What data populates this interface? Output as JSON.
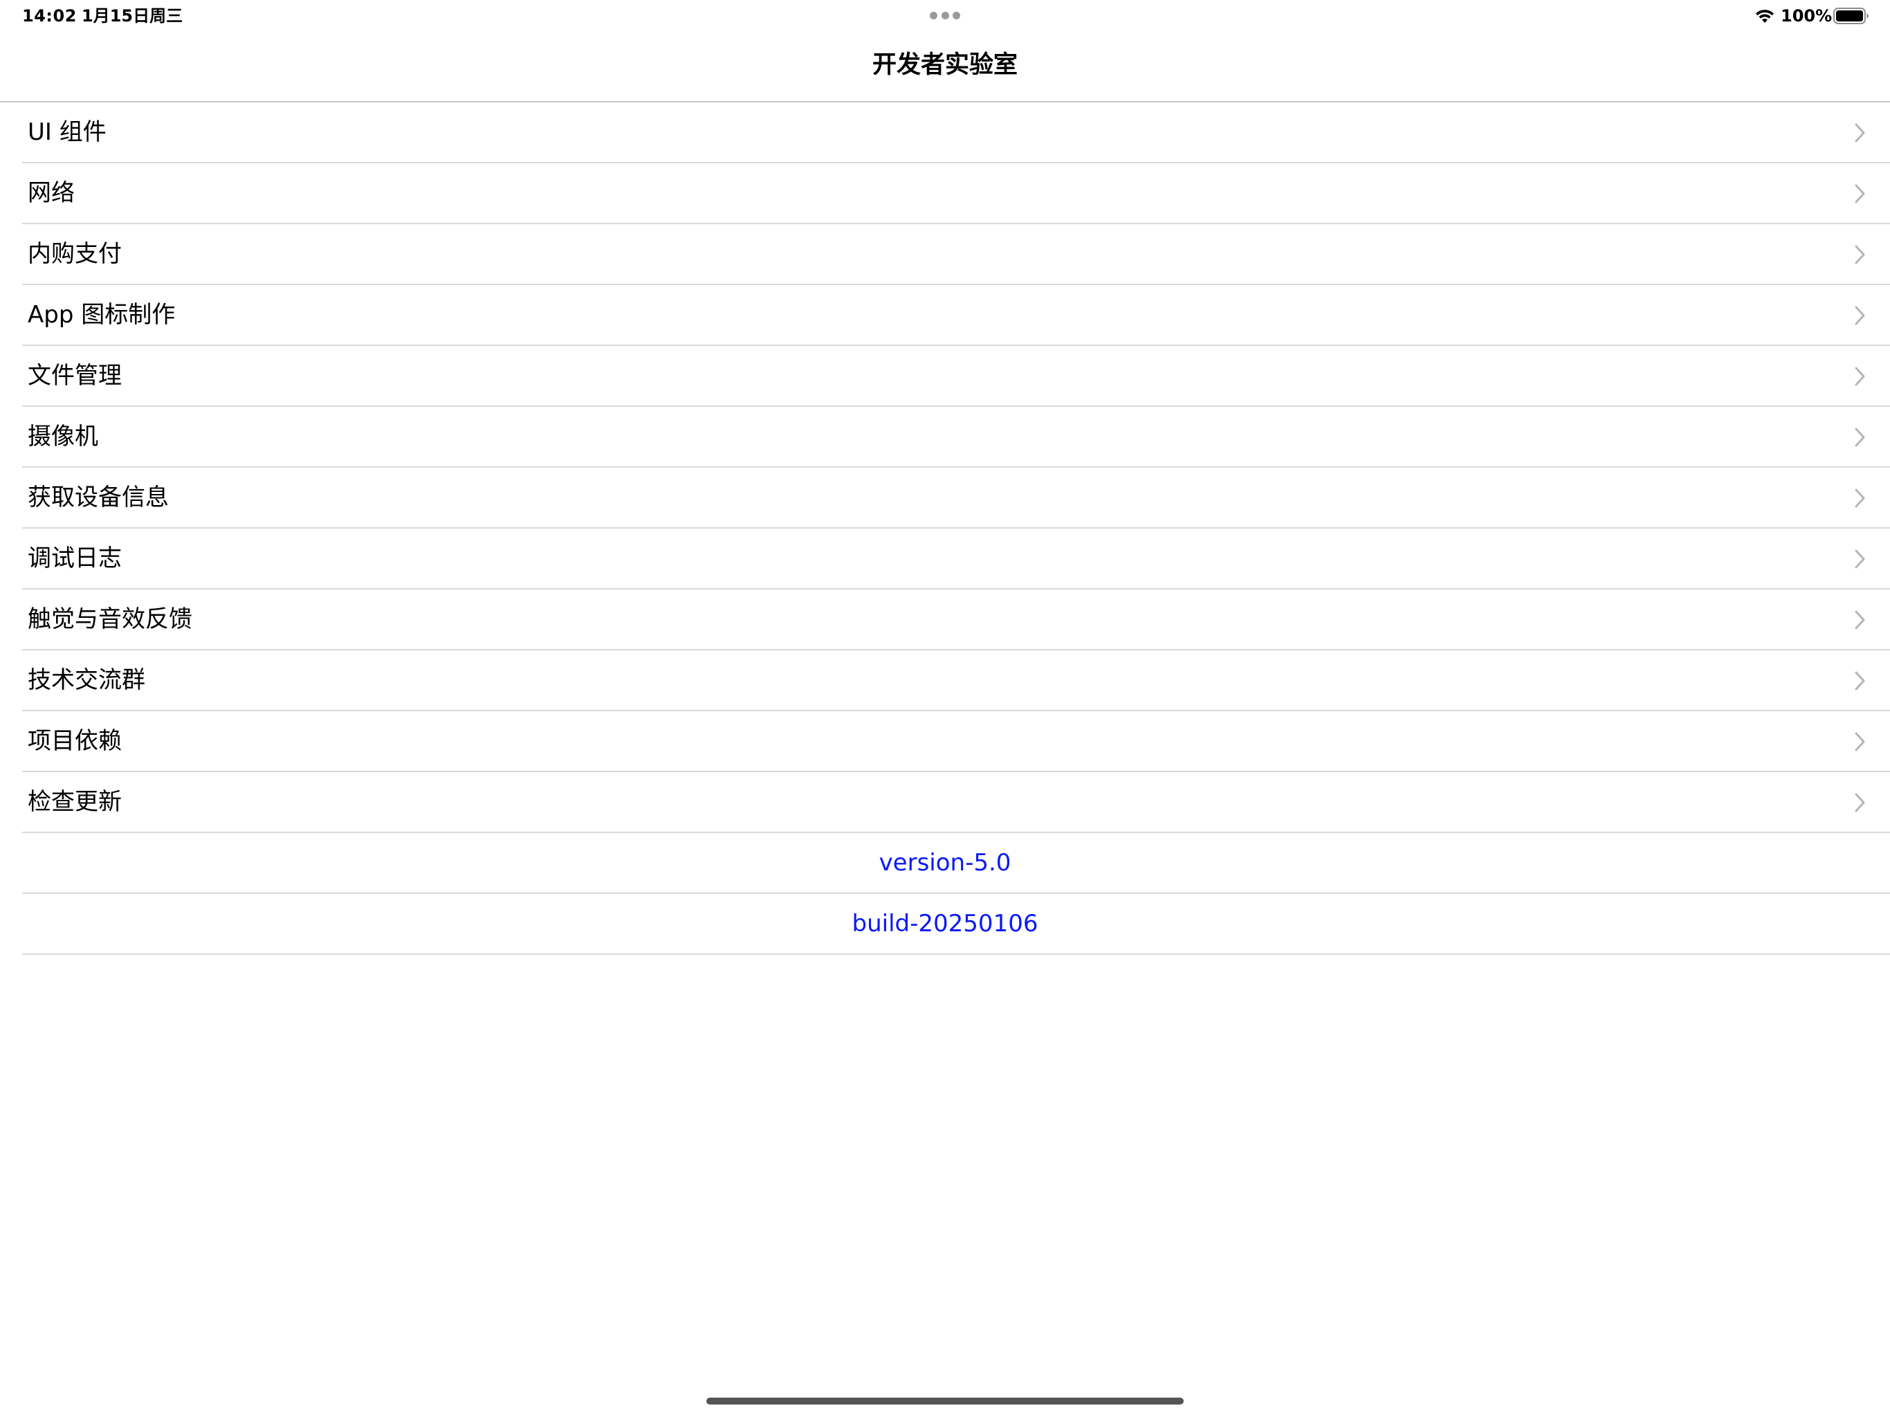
{
  "status_bar": {
    "time": "14:02",
    "date": "1月15日周三",
    "battery_percent": "100%",
    "battery_level": 1.0,
    "wifi_icon": "wifi-icon",
    "battery_icon": "battery-icon"
  },
  "nav": {
    "title": "开发者实验室"
  },
  "menu": {
    "items": [
      {
        "label": "UI 组件"
      },
      {
        "label": "网络"
      },
      {
        "label": "内购支付"
      },
      {
        "label": "App 图标制作"
      },
      {
        "label": "文件管理"
      },
      {
        "label": "摄像机"
      },
      {
        "label": "获取设备信息"
      },
      {
        "label": "调试日志"
      },
      {
        "label": "触觉与音效反馈"
      },
      {
        "label": "技术交流群"
      },
      {
        "label": "项目依赖"
      },
      {
        "label": "检查更新"
      }
    ],
    "chevron_icon": "chevron-right-icon"
  },
  "info": {
    "version": "version-5.0",
    "build": "build-20250106"
  },
  "colors": {
    "accent": "#0a19f5",
    "separator": "#d9d9dc",
    "chevron": "#b5b5b9",
    "text": "#000000",
    "background": "#ffffff"
  }
}
